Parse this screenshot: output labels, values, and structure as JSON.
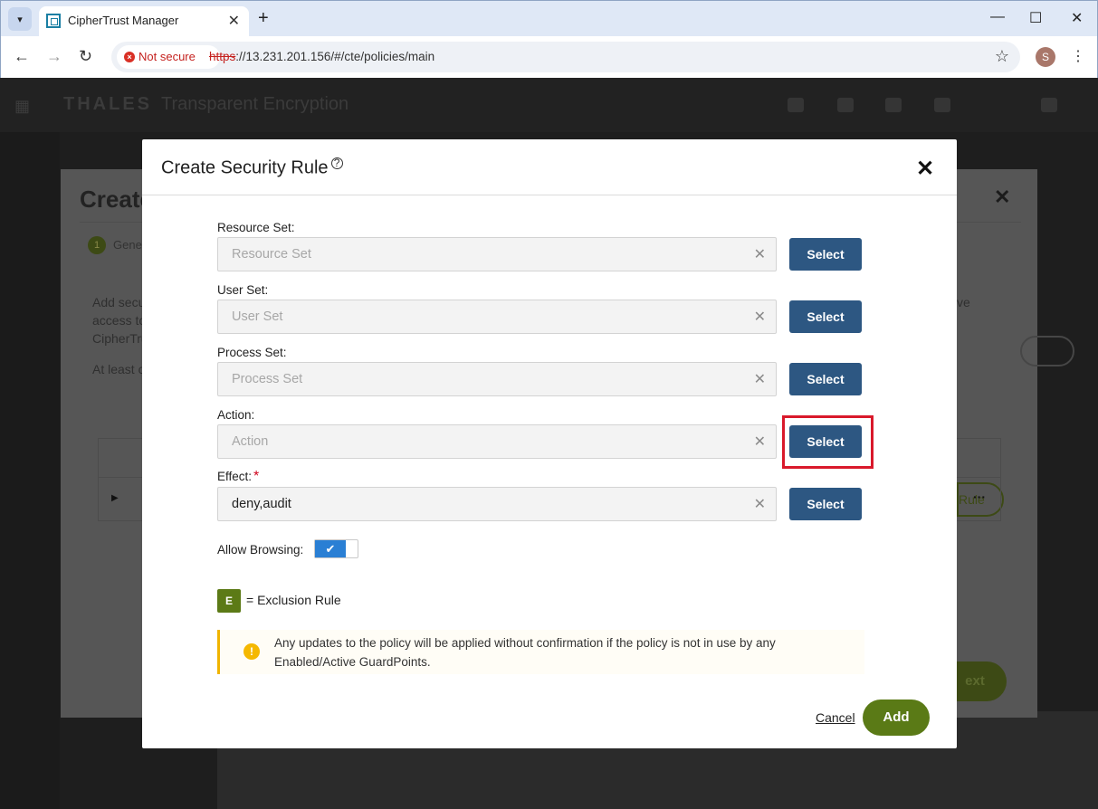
{
  "browser": {
    "tab_title": "CipherTrust Manager",
    "new_tab": "+",
    "security_label": "Not secure",
    "url_scheme": "https",
    "url_rest": "://13.231.201.156/#/cte/policies/main",
    "profile_initial": "S"
  },
  "app": {
    "brand": "THALES",
    "brand_sub": "Transparent Encryption"
  },
  "background_wizard": {
    "title": "Create",
    "step_number": "1",
    "step_label": "Gene",
    "text_lines": [
      "Add secu",
      "access to",
      "CipherTru"
    ],
    "text_line_2": "At least o",
    "right_text": "ve",
    "rule_button": "Rule",
    "next_button": "ext"
  },
  "dialog": {
    "title": "Create Security Rule",
    "help_icon": "?",
    "fields": [
      {
        "label": "Resource Set:",
        "placeholder": "Resource Set",
        "value": "",
        "required": false,
        "button": "Select"
      },
      {
        "label": "User Set:",
        "placeholder": "User Set",
        "value": "",
        "required": false,
        "button": "Select"
      },
      {
        "label": "Process Set:",
        "placeholder": "Process Set",
        "value": "",
        "required": false,
        "button": "Select"
      },
      {
        "label": "Action:",
        "placeholder": "Action",
        "value": "",
        "required": false,
        "button": "Select"
      },
      {
        "label": "Effect:",
        "placeholder": "",
        "value": "deny,audit",
        "required": true,
        "button": "Select"
      }
    ],
    "allow_browsing_label": "Allow Browsing:",
    "allow_browsing_on": true,
    "exclusion_badge": "E",
    "exclusion_text": "= Exclusion Rule",
    "notice_text": "Any updates to the policy will be applied without confirmation if the policy is not in use by any Enabled/Active GuardPoints.",
    "cancel_label": "Cancel",
    "add_label": "Add"
  },
  "colors": {
    "select_button": "#2d5782",
    "add_button": "#5a7a16",
    "notice_accent": "#f0b400",
    "highlight": "#d9192b"
  }
}
